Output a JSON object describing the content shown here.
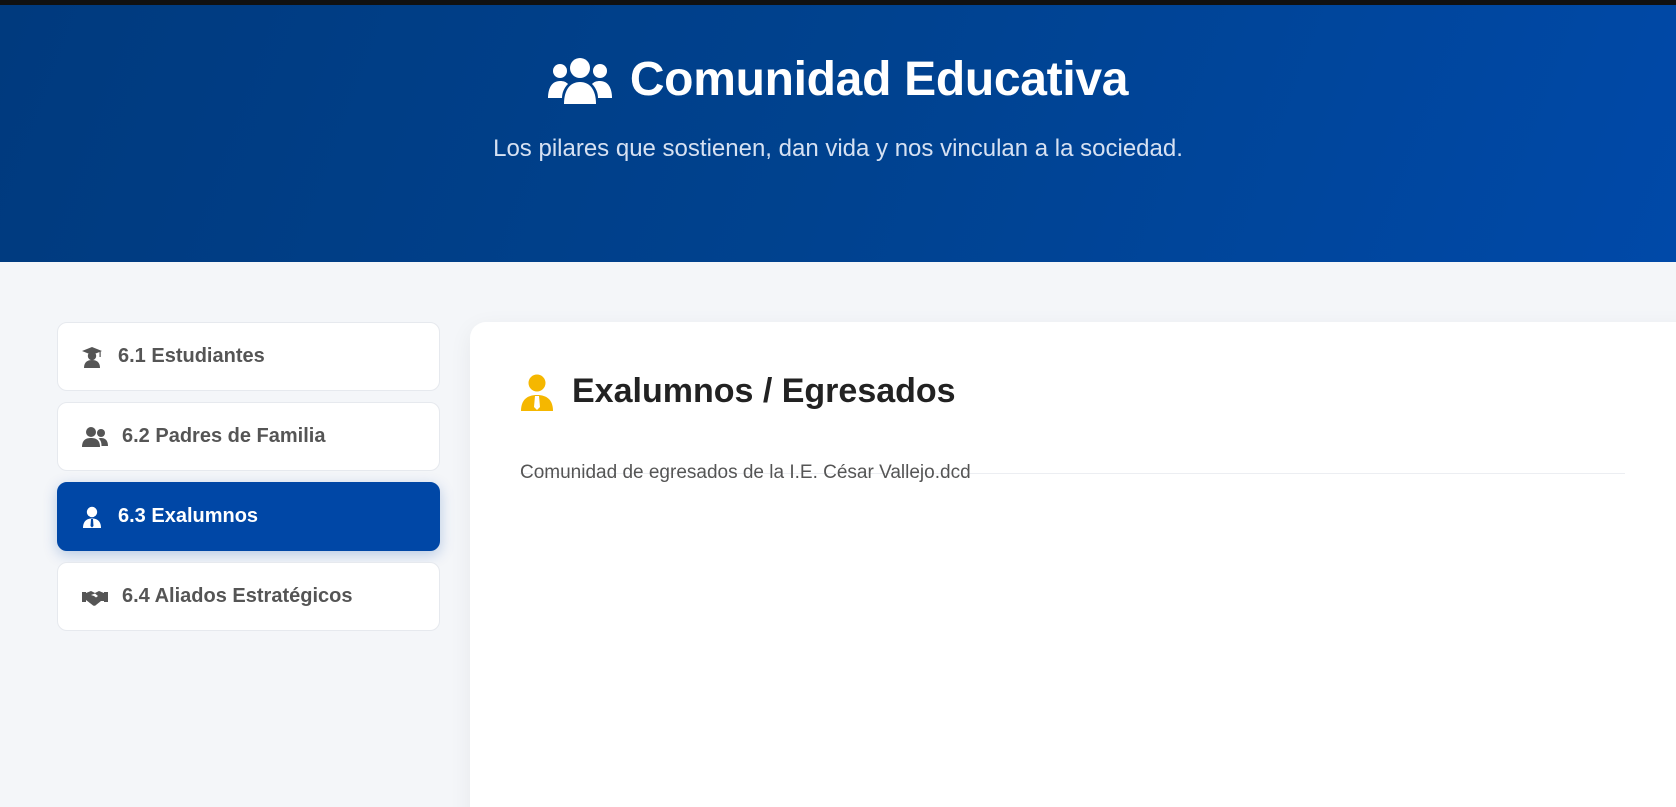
{
  "hero": {
    "title": "Comunidad Educativa",
    "subtitle": "Los pilares que sostienen, dan vida y nos vinculan a la sociedad.",
    "icon": "users-icon"
  },
  "sidebar": {
    "items": [
      {
        "label": "6.1 Estudiantes",
        "icon": "graduate-icon",
        "active": false
      },
      {
        "label": "6.2 Padres de Familia",
        "icon": "users-icon",
        "active": false
      },
      {
        "label": "6.3 Exalumnos",
        "icon": "user-tie-icon",
        "active": true
      },
      {
        "label": "6.4 Aliados Estratégicos",
        "icon": "handshake-icon",
        "active": false
      }
    ]
  },
  "content": {
    "title": "Exalumnos / Egresados",
    "icon": "user-tie-icon",
    "body": "Comunidad de egresados de la I.E. César Vallejo.dcd"
  },
  "colors": {
    "primary": "#0047a6",
    "hero_dark": "#003a7e",
    "accent_yellow": "#f5b700"
  }
}
